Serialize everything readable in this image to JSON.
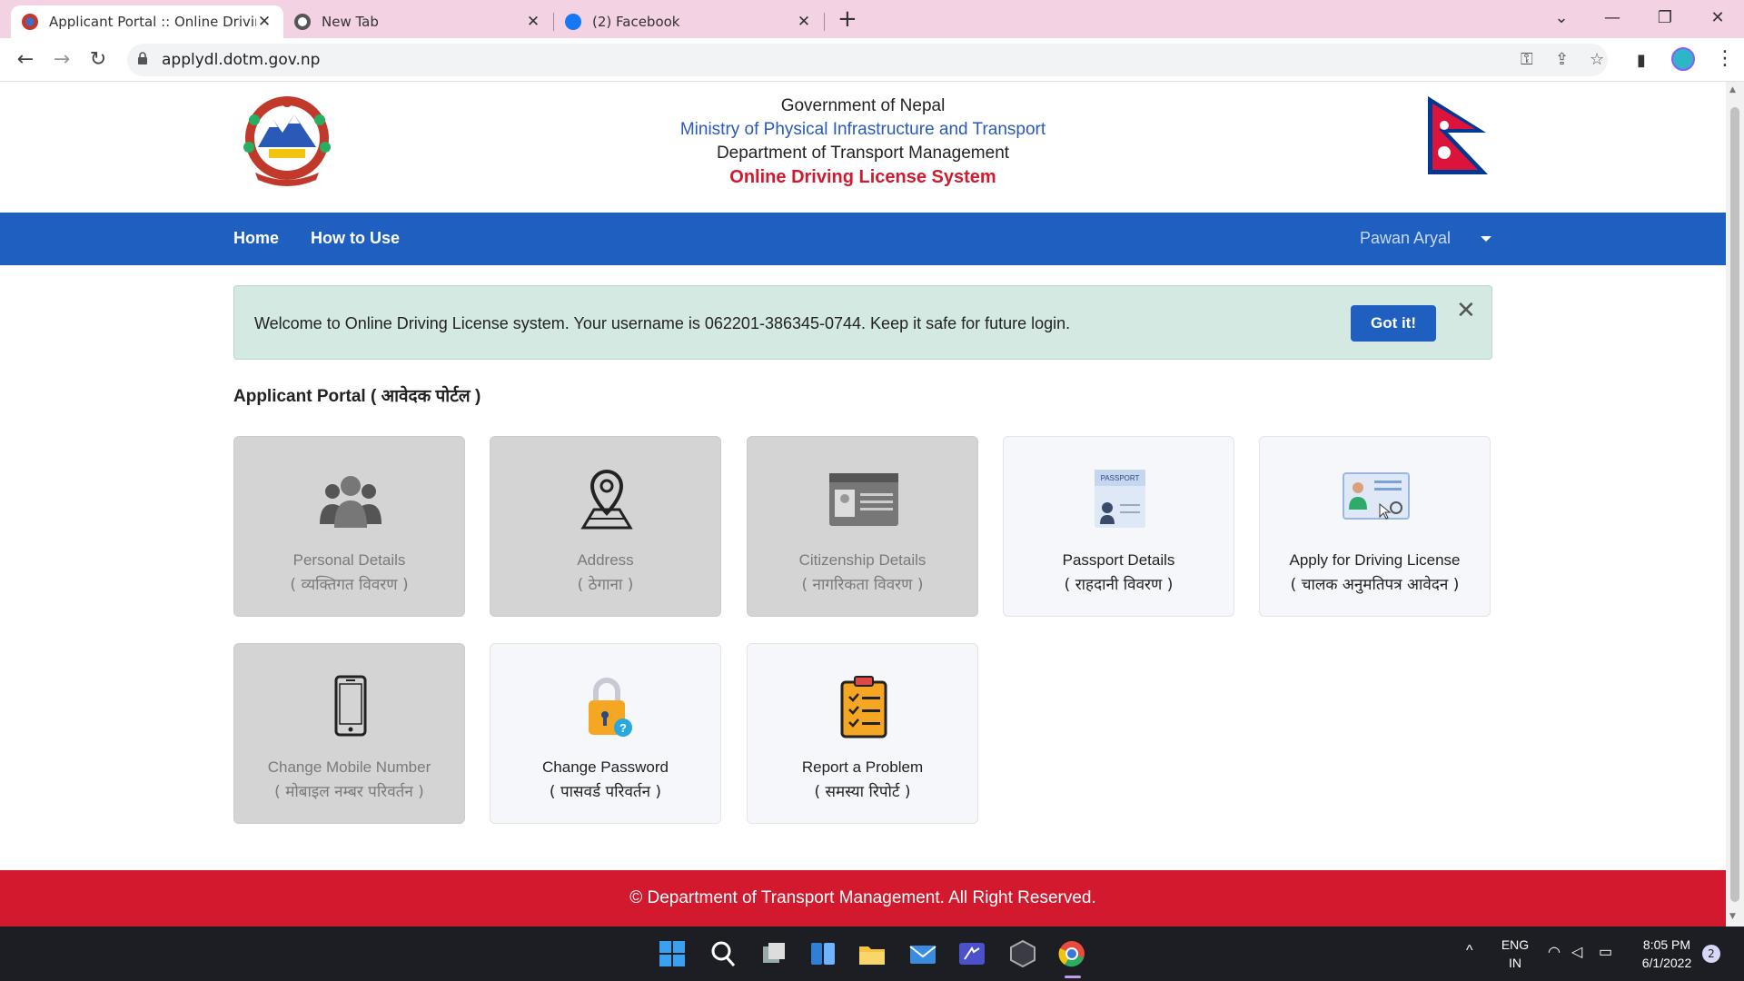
{
  "browser": {
    "tabs": [
      {
        "title": "Applicant Portal :: Online Driving",
        "active": true
      },
      {
        "title": "New Tab",
        "active": false
      },
      {
        "title": "(2) Facebook",
        "active": false
      }
    ],
    "new_tab": "+",
    "url": "applydl.dotm.gov.np"
  },
  "header": {
    "line1": "Government of Nepal",
    "line2": "Ministry of Physical Infrastructure and Transport",
    "line3": "Department of Transport Management",
    "line4": "Online Driving License System"
  },
  "nav": {
    "home": "Home",
    "how_to_use": "How to Use",
    "user": "Pawan Aryal"
  },
  "alert": {
    "message": "Welcome to Online Driving License system. Your username is 062201-386345-0744. Keep it safe for future login.",
    "button": "Got it!",
    "close": "✕"
  },
  "portal": {
    "title": "Applicant Portal ( आवेदक पोर्टल )",
    "cards": [
      {
        "label": "Personal Details",
        "label_np": "( व्यक्तिगत विवरण )",
        "icon": "people-icon",
        "enabled": false
      },
      {
        "label": "Address",
        "label_np": "( ठेगाना )",
        "icon": "location-pin-icon",
        "enabled": false
      },
      {
        "label": "Citizenship Details",
        "label_np": "( नागरिकता विवरण )",
        "icon": "id-card-icon",
        "enabled": false
      },
      {
        "label": "Passport Details",
        "label_np": "( राहदानी विवरण )",
        "icon": "passport-icon",
        "enabled": true
      },
      {
        "label": "Apply for Driving License",
        "label_np": "( चालक अनुमतिपत्र आवेदन )",
        "icon": "license-icon",
        "enabled": true
      },
      {
        "label": "Change Mobile Number",
        "label_np": "( मोबाइल नम्बर परिवर्तन )",
        "icon": "mobile-icon",
        "enabled": false
      },
      {
        "label": "Change Password",
        "label_np": "( पासवर्ड परिवर्तन )",
        "icon": "padlock-icon",
        "enabled": true
      },
      {
        "label": "Report a Problem",
        "label_np": "( समस्या रिपोर्ट )",
        "icon": "clipboard-icon",
        "enabled": true
      }
    ]
  },
  "footer": {
    "text": "© Department of Transport Management. All Right Reserved."
  },
  "taskbar": {
    "lang1": "ENG",
    "lang2": "IN",
    "time": "8:05 PM",
    "date": "6/1/2022",
    "notifications": "2"
  },
  "colors": {
    "nav_blue": "#1f5fbf",
    "footer_red": "#d2192d",
    "alert_bg": "#d5e9e3",
    "tab_strip": "#f3d2e3"
  }
}
